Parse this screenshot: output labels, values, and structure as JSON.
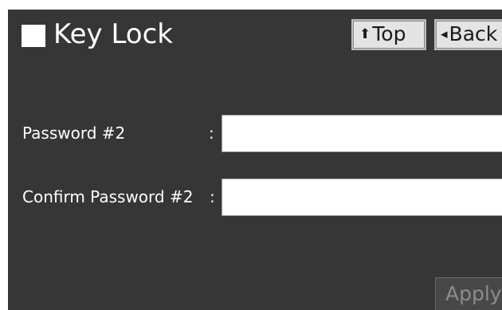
{
  "header": {
    "title": "Key Lock",
    "icon": "white-square-icon"
  },
  "nav": {
    "top_label": "Top",
    "top_icon": "arrow-up-icon",
    "back_label": "Back",
    "back_icon": "triangle-left-icon"
  },
  "form": {
    "password": {
      "label": "Password  #2",
      "colon": ":",
      "value": ""
    },
    "confirm": {
      "label": "Confirm Password  #2",
      "colon": ":",
      "value": ""
    }
  },
  "footer": {
    "apply_label": "Apply",
    "apply_enabled": false
  },
  "colors": {
    "panel_background": "#363636",
    "page_background": "#ffffff",
    "button_face": "#e4e4e4",
    "disabled_button": "#484848",
    "text": "#ffffff"
  }
}
